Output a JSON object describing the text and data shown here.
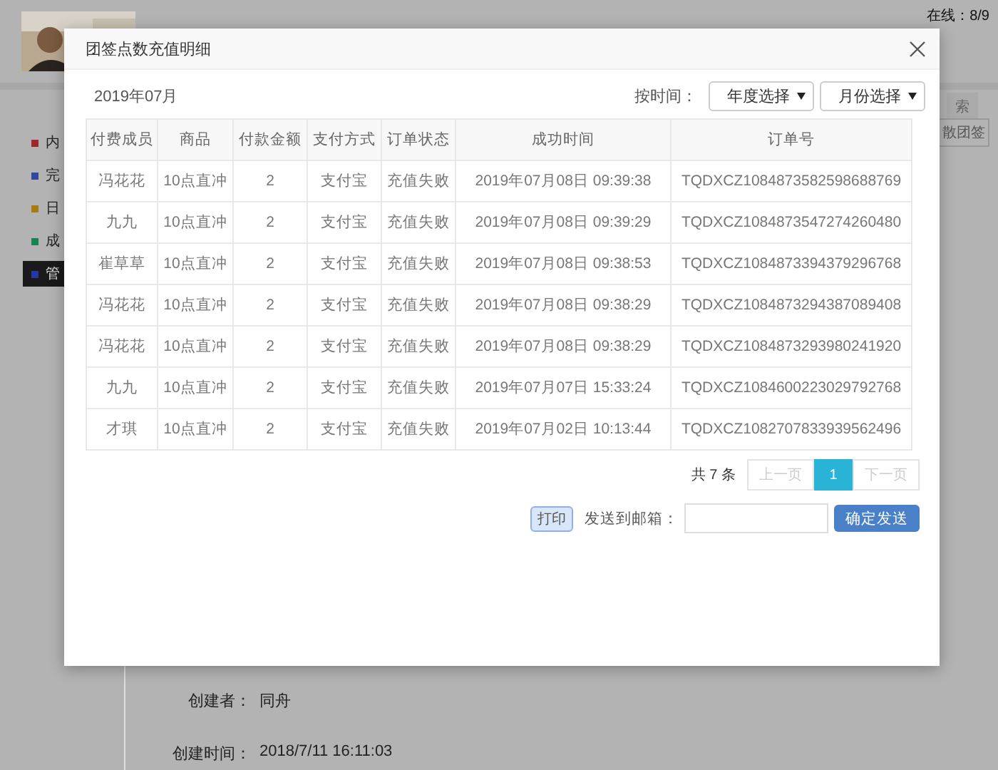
{
  "page": {
    "online": "在线：8/9",
    "search_button": "索",
    "side_items": [
      {
        "label": "内",
        "color": "#a02828",
        "selected": false
      },
      {
        "label": "完",
        "color": "#3048a0",
        "selected": false
      },
      {
        "label": "日",
        "color": "#a87a14",
        "selected": false
      },
      {
        "label": "成",
        "color": "#188454",
        "selected": false
      },
      {
        "label": "管",
        "color": "#2438a0",
        "selected": true
      }
    ],
    "action_button": "散团签",
    "fields": [
      {
        "label": "创建者：",
        "value": "同舟"
      },
      {
        "label": "创建时间：",
        "value": "2018/7/11 16:11:03"
      }
    ]
  },
  "dialog": {
    "title": "团签点数充值明细",
    "period": "2019年07月",
    "filter_label": "按时间：",
    "filters": [
      "年度选择",
      "月份选择"
    ],
    "table": {
      "columns": [
        "付费成员",
        "商品",
        "付款金额",
        "支付方式",
        "订单状态",
        "成功时间",
        "订单号"
      ],
      "rows": [
        [
          "冯花花",
          "10点直冲",
          "2",
          "支付宝",
          "充值失败",
          "2019年07月08日 09:39:38",
          "TQDXCZ1084873582598688769"
        ],
        [
          "九九",
          "10点直冲",
          "2",
          "支付宝",
          "充值失败",
          "2019年07月08日 09:39:29",
          "TQDXCZ1084873547274260480"
        ],
        [
          "崔草草",
          "10点直冲",
          "2",
          "支付宝",
          "充值失败",
          "2019年07月08日 09:38:53",
          "TQDXCZ1084873394379296768"
        ],
        [
          "冯花花",
          "10点直冲",
          "2",
          "支付宝",
          "充值失败",
          "2019年07月08日 09:38:29",
          "TQDXCZ1084873294387089408"
        ],
        [
          "冯花花",
          "10点直冲",
          "2",
          "支付宝",
          "充值失败",
          "2019年07月08日 09:38:29",
          "TQDXCZ1084873293980241920"
        ],
        [
          "九九",
          "10点直冲",
          "2",
          "支付宝",
          "充值失败",
          "2019年07月07日 15:33:24",
          "TQDXCZ1084600223029792768"
        ],
        [
          "才琪",
          "10点直冲",
          "2",
          "支付宝",
          "充值失败",
          "2019年07月02日 10:13:44",
          "TQDXCZ1082707833939562496"
        ]
      ]
    },
    "pagination": {
      "total": "共 7 条",
      "prev": {
        "label": "上一页",
        "disabled": true
      },
      "pages": [
        {
          "label": "1",
          "selected": true
        }
      ],
      "next": {
        "label": "下一页",
        "disabled": true
      }
    },
    "print_button": "打印",
    "email_label": "发送到邮箱：",
    "send_button": "确定发送"
  }
}
